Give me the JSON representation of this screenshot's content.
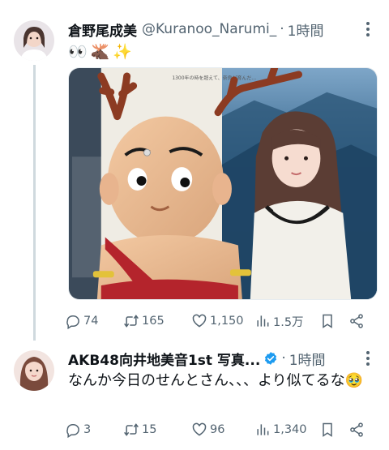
{
  "tweet1": {
    "display_name": "倉野尾成美",
    "handle": "@Kuranoo_Narumi_",
    "separator": "·",
    "time": "1時間",
    "body_emojis": [
      "👀",
      "🫎",
      "✨"
    ],
    "stats": {
      "replies": "74",
      "retweets": "165",
      "likes": "1,150",
      "views": "1.5万"
    }
  },
  "tweet2": {
    "display_name": "AKB48向井地美音1st 写真...",
    "separator": "·",
    "time": "1時間",
    "text": "なんか今日のせんとさん、、、より似てるな🥹",
    "stats": {
      "replies": "3",
      "retweets": "15",
      "likes": "96",
      "views": "1,340"
    }
  },
  "photo_sign_text": "1300年の時を超えて、奈良が育んだ…",
  "colors": {
    "text": "#0f1419",
    "muted": "#536471",
    "line": "#cfd9de",
    "verified": "#1d9bf0"
  }
}
